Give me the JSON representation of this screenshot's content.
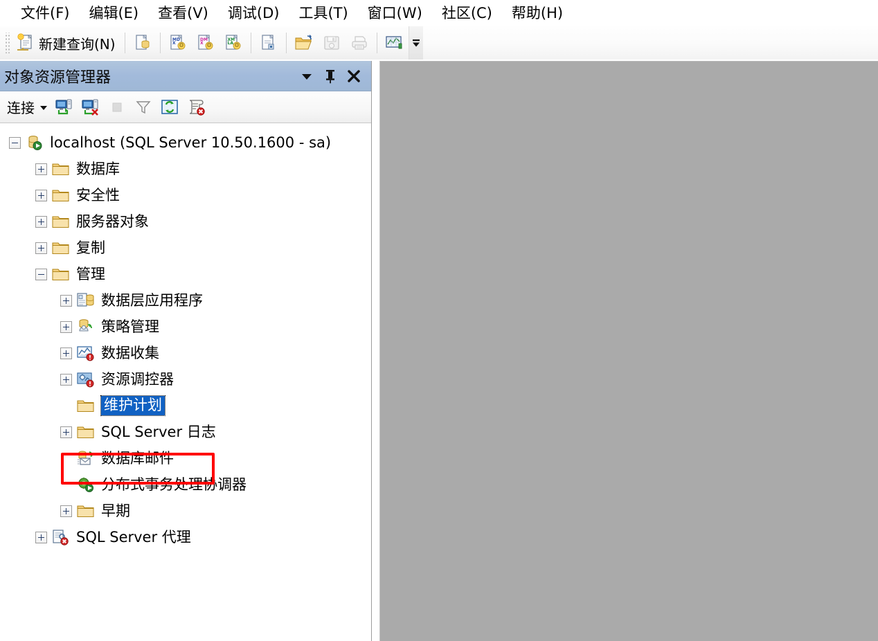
{
  "window": {
    "app": "SQL Server Management Studio"
  },
  "menubar": {
    "items": [
      {
        "label": "文件(F)",
        "name": "menu-file"
      },
      {
        "label": "编辑(E)",
        "name": "menu-edit"
      },
      {
        "label": "查看(V)",
        "name": "menu-view"
      },
      {
        "label": "调试(D)",
        "name": "menu-debug"
      },
      {
        "label": "工具(T)",
        "name": "menu-tools"
      },
      {
        "label": "窗口(W)",
        "name": "menu-window"
      },
      {
        "label": "社区(C)",
        "name": "menu-community"
      },
      {
        "label": "帮助(H)",
        "name": "menu-help"
      }
    ]
  },
  "toolbar": {
    "new_query_label": "新建查询(N)",
    "buttons": [
      {
        "name": "new-query-button",
        "icon": "new-query-icon"
      },
      {
        "name": "database-engine-query-button",
        "icon": "database-engine-query-icon"
      },
      {
        "name": "analysis-services-mdx-query-button",
        "icon": "mdx-query-icon"
      },
      {
        "name": "analysis-services-dmx-query-button",
        "icon": "dmx-query-icon"
      },
      {
        "name": "analysis-services-xmla-query-button",
        "icon": "xmla-query-icon"
      },
      {
        "name": "sql-server-compact-query-button",
        "icon": "compact-query-icon"
      },
      {
        "name": "open-file-button",
        "icon": "open-folder-icon"
      },
      {
        "name": "save-button",
        "icon": "floppy-disk-icon"
      },
      {
        "name": "print-button",
        "icon": "printer-icon"
      },
      {
        "name": "activity-monitor-button",
        "icon": "activity-monitor-icon"
      },
      {
        "name": "toolbar-overflow-button",
        "icon": "chevron-down-icon"
      }
    ]
  },
  "object_explorer": {
    "title": "对象资源管理器",
    "title_buttons": [
      {
        "name": "window-position-dropdown-button",
        "icon": "chevron-down-icon"
      },
      {
        "name": "auto-hide-pin-button",
        "icon": "pin-icon"
      },
      {
        "name": "close-panel-button",
        "icon": "close-icon"
      }
    ],
    "toolbar": {
      "connect_label": "连接",
      "buttons": [
        {
          "name": "connect-dropdown-button",
          "icon": "chevron-down-icon"
        },
        {
          "name": "connect-object-explorer-button",
          "icon": "server-connect-icon"
        },
        {
          "name": "disconnect-object-explorer-button",
          "icon": "server-disconnect-icon"
        },
        {
          "name": "stop-button",
          "icon": "stop-square-icon"
        },
        {
          "name": "filter-button",
          "icon": "funnel-icon"
        },
        {
          "name": "refresh-button",
          "icon": "refresh-icon"
        },
        {
          "name": "cancel-report-button",
          "icon": "script-cancel-icon"
        }
      ]
    },
    "tree": [
      {
        "label": "localhost (SQL Server 10.50.1600 - sa)",
        "name": "tree-node-server",
        "icon": "server-running-icon",
        "depth": 0,
        "expander": "minus",
        "selected": false
      },
      {
        "label": "数据库",
        "name": "tree-node-databases",
        "icon": "folder-icon",
        "depth": 1,
        "expander": "plus",
        "selected": false
      },
      {
        "label": "安全性",
        "name": "tree-node-security",
        "icon": "folder-icon",
        "depth": 1,
        "expander": "plus",
        "selected": false
      },
      {
        "label": "服务器对象",
        "name": "tree-node-server-objects",
        "icon": "folder-icon",
        "depth": 1,
        "expander": "plus",
        "selected": false
      },
      {
        "label": "复制",
        "name": "tree-node-replication",
        "icon": "folder-icon",
        "depth": 1,
        "expander": "plus",
        "selected": false
      },
      {
        "label": "管理",
        "name": "tree-node-management",
        "icon": "folder-icon",
        "depth": 1,
        "expander": "minus",
        "selected": false
      },
      {
        "label": "数据层应用程序",
        "name": "tree-node-data-tier-applications",
        "icon": "data-tier-application-icon",
        "depth": 2,
        "expander": "plus",
        "selected": false
      },
      {
        "label": "策略管理",
        "name": "tree-node-policy-management",
        "icon": "policy-management-icon",
        "depth": 2,
        "expander": "plus",
        "selected": false
      },
      {
        "label": "数据收集",
        "name": "tree-node-data-collection",
        "icon": "data-collection-icon",
        "depth": 2,
        "expander": "plus",
        "selected": false
      },
      {
        "label": "资源调控器",
        "name": "tree-node-resource-governor",
        "icon": "resource-governor-icon",
        "depth": 2,
        "expander": "plus",
        "selected": false
      },
      {
        "label": "维护计划",
        "name": "tree-node-maintenance-plans",
        "icon": "folder-icon",
        "depth": 2,
        "expander": "none",
        "selected": true
      },
      {
        "label": "SQL Server 日志",
        "name": "tree-node-sql-server-logs",
        "icon": "folder-icon",
        "depth": 2,
        "expander": "plus",
        "selected": false
      },
      {
        "label": "数据库邮件",
        "name": "tree-node-database-mail",
        "icon": "database-mail-icon",
        "depth": 2,
        "expander": "none",
        "selected": false
      },
      {
        "label": "分布式事务处理协调器",
        "name": "tree-node-distributed-transaction-coordinator",
        "icon": "dtc-icon",
        "depth": 2,
        "expander": "none",
        "selected": false
      },
      {
        "label": "早期",
        "name": "tree-node-legacy",
        "icon": "folder-icon",
        "depth": 2,
        "expander": "plus",
        "selected": false
      },
      {
        "label": "SQL Server 代理",
        "name": "tree-node-sql-server-agent",
        "icon": "sql-agent-stopped-icon",
        "depth": 1,
        "expander": "plus",
        "selected": false
      }
    ]
  },
  "annotation": {
    "highlight_target": "维护计划",
    "color": "#ff0000"
  },
  "colors": {
    "panel_title_blue": "#a2badb",
    "selection_blue": "#1061c3",
    "document_area_gray": "#aaaaaa",
    "folder_yellow": "#f5d785",
    "annotation_red": "#ff0000"
  }
}
